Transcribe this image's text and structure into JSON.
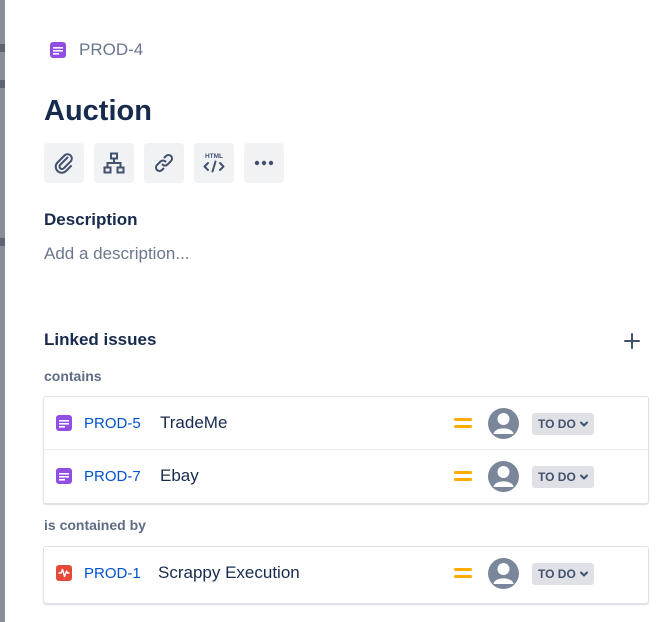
{
  "issue": {
    "key": "PROD-4",
    "type_icon": "story-icon",
    "title": "Auction"
  },
  "toolbar": [
    {
      "name": "attach-button",
      "icon": "paperclip-icon"
    },
    {
      "name": "child-issue-button",
      "icon": "hierarchy-icon"
    },
    {
      "name": "link-issue-button",
      "icon": "link-icon"
    },
    {
      "name": "html-button",
      "icon": "html-code-icon",
      "icon_text": "HTML"
    },
    {
      "name": "more-actions-button",
      "icon": "ellipsis-icon"
    }
  ],
  "description": {
    "heading": "Description",
    "placeholder": "Add a description..."
  },
  "linked_issues": {
    "heading": "Linked issues",
    "add_icon": "plus-icon",
    "groups": [
      {
        "relation": "contains",
        "items": [
          {
            "key": "PROD-5",
            "summary": "TradeMe",
            "type": "story",
            "priority": "medium",
            "status": "TO DO"
          },
          {
            "key": "PROD-7",
            "summary": "Ebay",
            "type": "story",
            "priority": "medium",
            "status": "TO DO"
          }
        ]
      },
      {
        "relation": "is contained by",
        "items": [
          {
            "key": "PROD-1",
            "summary": "Scrappy Execution",
            "type": "epic",
            "priority": "medium",
            "status": "TO DO"
          }
        ]
      }
    ]
  },
  "colors": {
    "story": "#904EE2",
    "epic": "#E5493A",
    "priority_medium": "#FFAB00",
    "link": "#0052CC",
    "text": "#172B4D",
    "subtle": "#6B778C",
    "status_bg": "#DFE1E6"
  }
}
